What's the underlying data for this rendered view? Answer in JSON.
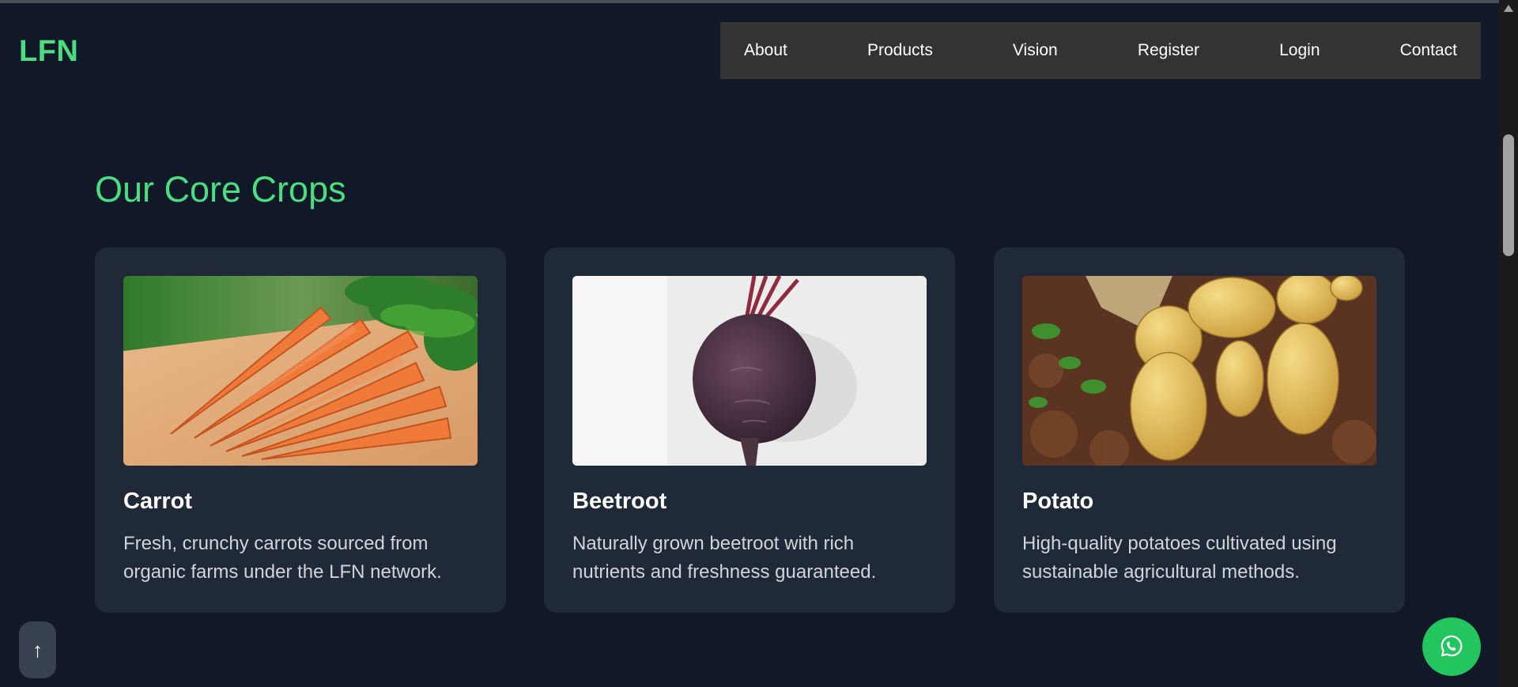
{
  "header": {
    "logo": "LFN",
    "nav": [
      "About",
      "Products",
      "Vision",
      "Register",
      "Login",
      "Contact"
    ]
  },
  "section": {
    "title": "Our Core Crops"
  },
  "crops": [
    {
      "name": "Carrot",
      "description": "Fresh, crunchy carrots sourced from organic farms under the LFN network.",
      "image_icon": "carrot-image"
    },
    {
      "name": "Beetroot",
      "description": "Naturally grown beetroot with rich nutrients and freshness guaranteed.",
      "image_icon": "beetroot-image"
    },
    {
      "name": "Potato",
      "description": "High-quality potatoes cultivated using sustainable agricultural methods.",
      "image_icon": "potato-image"
    }
  ],
  "floating": {
    "back_to_top_icon": "↑",
    "whatsapp_icon": "whatsapp-icon"
  },
  "colors": {
    "background": "#111827",
    "card": "#1f2937",
    "accent": "#4ade80",
    "nav_bg": "#333333",
    "whatsapp": "#22c55e"
  }
}
